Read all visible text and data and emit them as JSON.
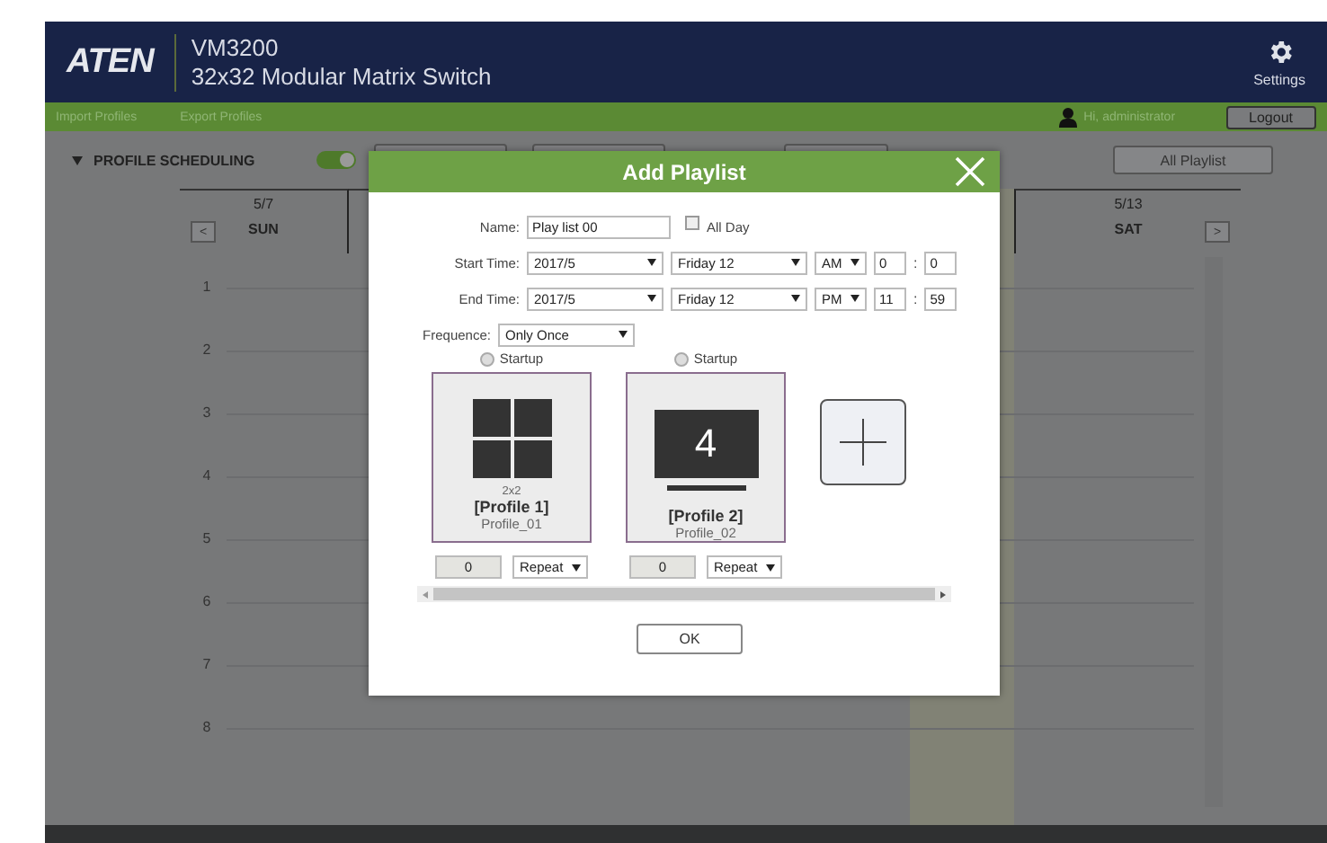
{
  "header": {
    "logo": "ATEN",
    "model": "VM3200",
    "product": "32x32 Modular Matrix Switch",
    "settings_label": "Settings"
  },
  "menu_bar": {
    "items": [
      "Import Profiles",
      "Export Profiles"
    ],
    "user": "Hi, administrator",
    "logout": "Logout"
  },
  "scheduling": {
    "title": "PROFILE SCHEDULING",
    "expanded": true,
    "enabled": true,
    "all_playlist": "All Playlist"
  },
  "calendar": {
    "prev": "<",
    "next": ">",
    "days": [
      {
        "date": "5/7",
        "day": "SUN"
      },
      {
        "date": "5/13",
        "day": "SAT"
      }
    ],
    "hours": [
      "1",
      "2",
      "3",
      "4",
      "5",
      "6",
      "7",
      "8"
    ]
  },
  "dialog": {
    "title": "Add Playlist",
    "name_label": "Name:",
    "name_value": "Play list 00",
    "all_day": {
      "label": "All Day",
      "checked": false
    },
    "times": [
      {
        "label": "Start Time:",
        "month": "2017/5",
        "day": "Friday 12",
        "ampm": "AM",
        "hour": "0",
        "separator": ":",
        "minute": "0"
      },
      {
        "label": "End Time:",
        "month": "2017/5",
        "day": "Friday 12",
        "ampm": "PM",
        "hour": "11",
        "separator": ":",
        "minute": "59"
      }
    ],
    "frequence": {
      "label": "Frequence:",
      "value": "Only Once"
    },
    "profiles": [
      {
        "kind": "grid",
        "startup_label": "Startup",
        "startup": false,
        "layout": "2x2",
        "name": "[Profile 1]",
        "id": "Profile_01",
        "count": "0",
        "mode": "Repeat"
      },
      {
        "kind": "single",
        "startup_label": "Startup",
        "startup": false,
        "screen": "4",
        "name": "[Profile 2]",
        "id": "Profile_02",
        "count": "0",
        "mode": "Repeat"
      }
    ],
    "ok": "OK"
  }
}
